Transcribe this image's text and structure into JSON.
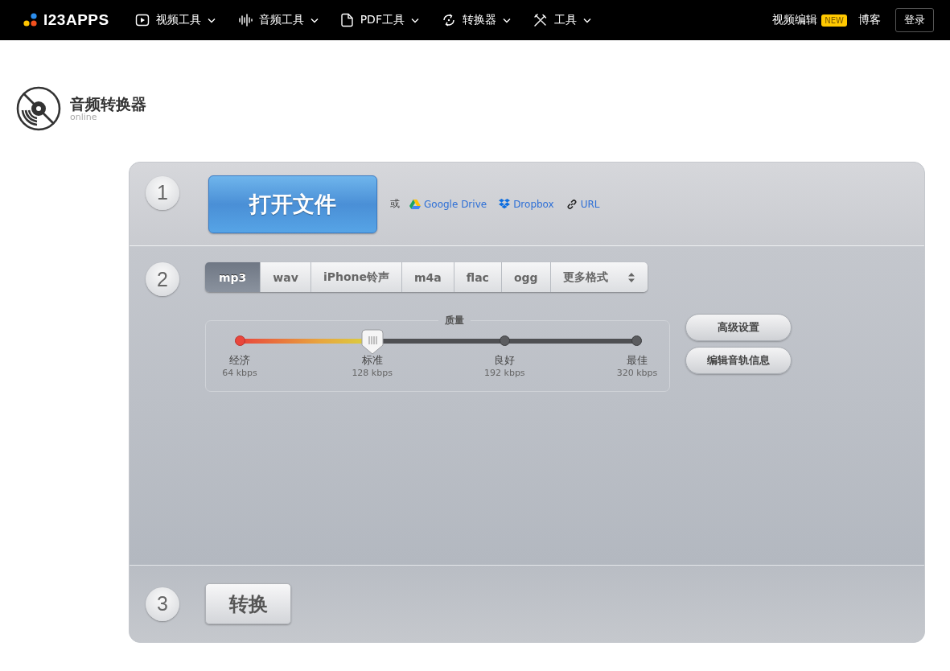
{
  "header": {
    "logo": "I23APPS",
    "nav": [
      {
        "kind": "video",
        "label": "视频工具"
      },
      {
        "kind": "audio",
        "label": "音频工具"
      },
      {
        "kind": "pdf",
        "label": "PDF工具"
      },
      {
        "kind": "converter",
        "label": "转换器"
      },
      {
        "kind": "tools",
        "label": "工具"
      }
    ],
    "video_editor": "视频编辑",
    "badge": "NEW",
    "blog": "博客",
    "login": "登录"
  },
  "app": {
    "title": "音频转换器",
    "subtitle": "online"
  },
  "step1": {
    "number": "1",
    "open_button": "打开文件",
    "or": "或",
    "sources": [
      {
        "kind": "drive",
        "label": "Google Drive"
      },
      {
        "kind": "dropbox",
        "label": "Dropbox"
      },
      {
        "kind": "link",
        "label": "URL"
      }
    ]
  },
  "step2": {
    "number": "2",
    "formats": [
      {
        "label": "mp3",
        "selected": true
      },
      {
        "label": "wav",
        "selected": false
      },
      {
        "label": "iPhone铃声",
        "selected": false
      },
      {
        "label": "m4a",
        "selected": false
      },
      {
        "label": "flac",
        "selected": false
      },
      {
        "label": "ogg",
        "selected": false
      }
    ],
    "more_formats": "更多格式",
    "quality": {
      "legend": "质量",
      "level": 0.333,
      "stops": [
        {
          "name": "经济",
          "rate": "64 kbps"
        },
        {
          "name": "标准",
          "rate": "128 kbps"
        },
        {
          "name": "良好",
          "rate": "192 kbps"
        },
        {
          "name": "最佳",
          "rate": "320 kbps"
        }
      ]
    },
    "buttons": [
      "高级设置",
      "编辑音轨信息"
    ]
  },
  "step3": {
    "number": "3",
    "convert_button": "转换"
  }
}
